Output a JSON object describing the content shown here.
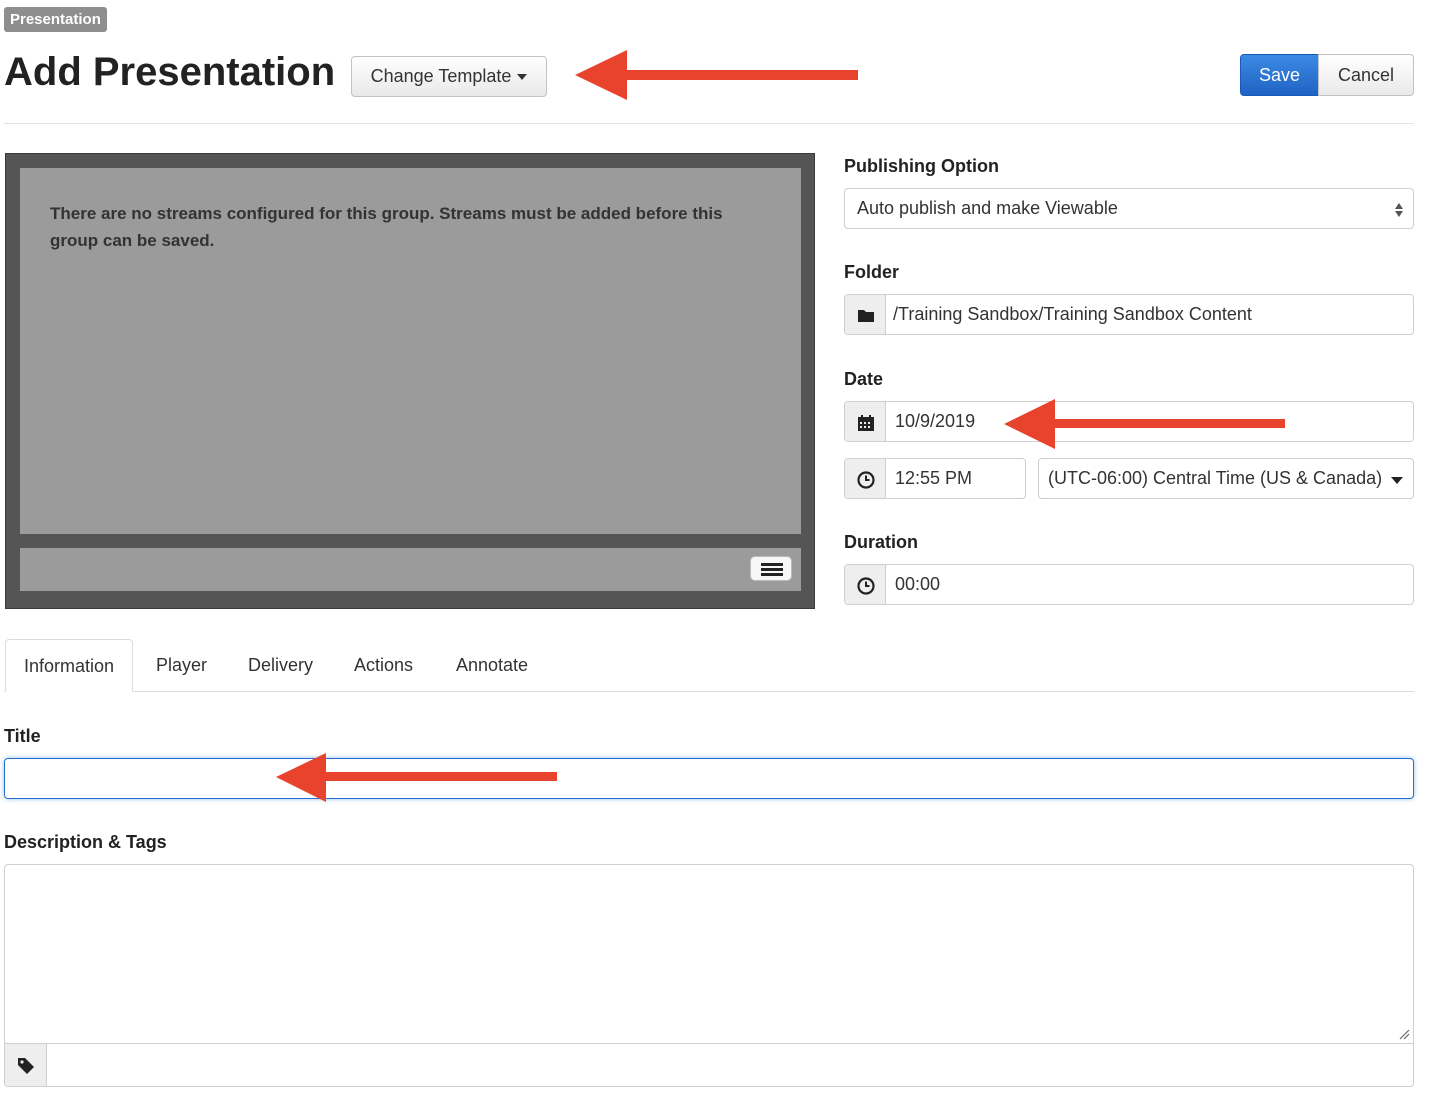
{
  "badge": "Presentation",
  "page_title": "Add Presentation",
  "toolbar": {
    "change_template_label": "Change Template",
    "save_label": "Save",
    "cancel_label": "Cancel"
  },
  "player": {
    "message": "There are no streams configured for this group. Streams must be added before this group can be saved."
  },
  "publishing": {
    "label": "Publishing Option",
    "value": "Auto publish and make Viewable"
  },
  "folder": {
    "label": "Folder",
    "value": "/Training Sandbox/Training Sandbox Content"
  },
  "date": {
    "label": "Date",
    "value": "10/9/2019",
    "time": "12:55 PM",
    "timezone": "(UTC-06:00) Central Time (US & Canada)"
  },
  "duration": {
    "label": "Duration",
    "value": "00:00"
  },
  "tabs": [
    {
      "label": "Information"
    },
    {
      "label": "Player"
    },
    {
      "label": "Delivery"
    },
    {
      "label": "Actions"
    },
    {
      "label": "Annotate"
    }
  ],
  "form": {
    "title_label": "Title",
    "title_value": "",
    "description_label": "Description & Tags",
    "description_value": "",
    "tags_value": ""
  },
  "colors": {
    "primary": "#1f63c4",
    "annotation_arrow": "#e8432d",
    "player_frame": "#555555",
    "player_screen": "#9b9b9b"
  },
  "icons": {
    "folder": "folder-icon",
    "calendar": "calendar-icon",
    "clock": "clock-icon",
    "tag": "tag-icon",
    "menu": "menu-icon"
  }
}
